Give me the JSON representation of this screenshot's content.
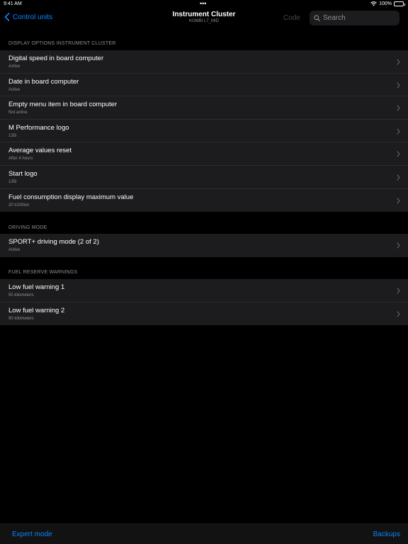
{
  "status_bar": {
    "time": "9:41 AM",
    "dots": "•••",
    "battery": "100%"
  },
  "nav": {
    "back_label": "Control units",
    "title": "Instrument Cluster",
    "subtitle": "KOMBI L7_MID",
    "code_label": "Code",
    "search_placeholder": "Search"
  },
  "sections": [
    {
      "header": "DISPLAY OPTIONS INSTRUMENT CLUSTER",
      "rows": [
        {
          "title": "Digital speed in board computer",
          "value": "Active"
        },
        {
          "title": "Date in board computer",
          "value": "Active"
        },
        {
          "title": "Empty menu item in board computer",
          "value": "Not active"
        },
        {
          "title": "M Performance logo",
          "value": "135i"
        },
        {
          "title": "Average values reset",
          "value": "After 4 hours"
        },
        {
          "title": "Start logo",
          "value": "135i"
        },
        {
          "title": "Fuel consumption display maximum value",
          "value": "20 l/100km"
        }
      ]
    },
    {
      "header": "DRIVING MODE",
      "rows": [
        {
          "title": "SPORT+ driving mode (2 of 2)",
          "value": "Active"
        }
      ]
    },
    {
      "header": "FUEL RESERVE WARNINGS",
      "rows": [
        {
          "title": "Low fuel warning 1",
          "value": "50 kilometers"
        },
        {
          "title": "Low fuel warning 2",
          "value": "90 kilometers"
        }
      ]
    }
  ],
  "toolbar": {
    "left_label": "Expert mode",
    "right_label": "Backups"
  },
  "colors": {
    "accent": "#0a84ff",
    "background": "#000000",
    "cell": "#1c1c1e",
    "secondary_text": "#8e8e93"
  }
}
